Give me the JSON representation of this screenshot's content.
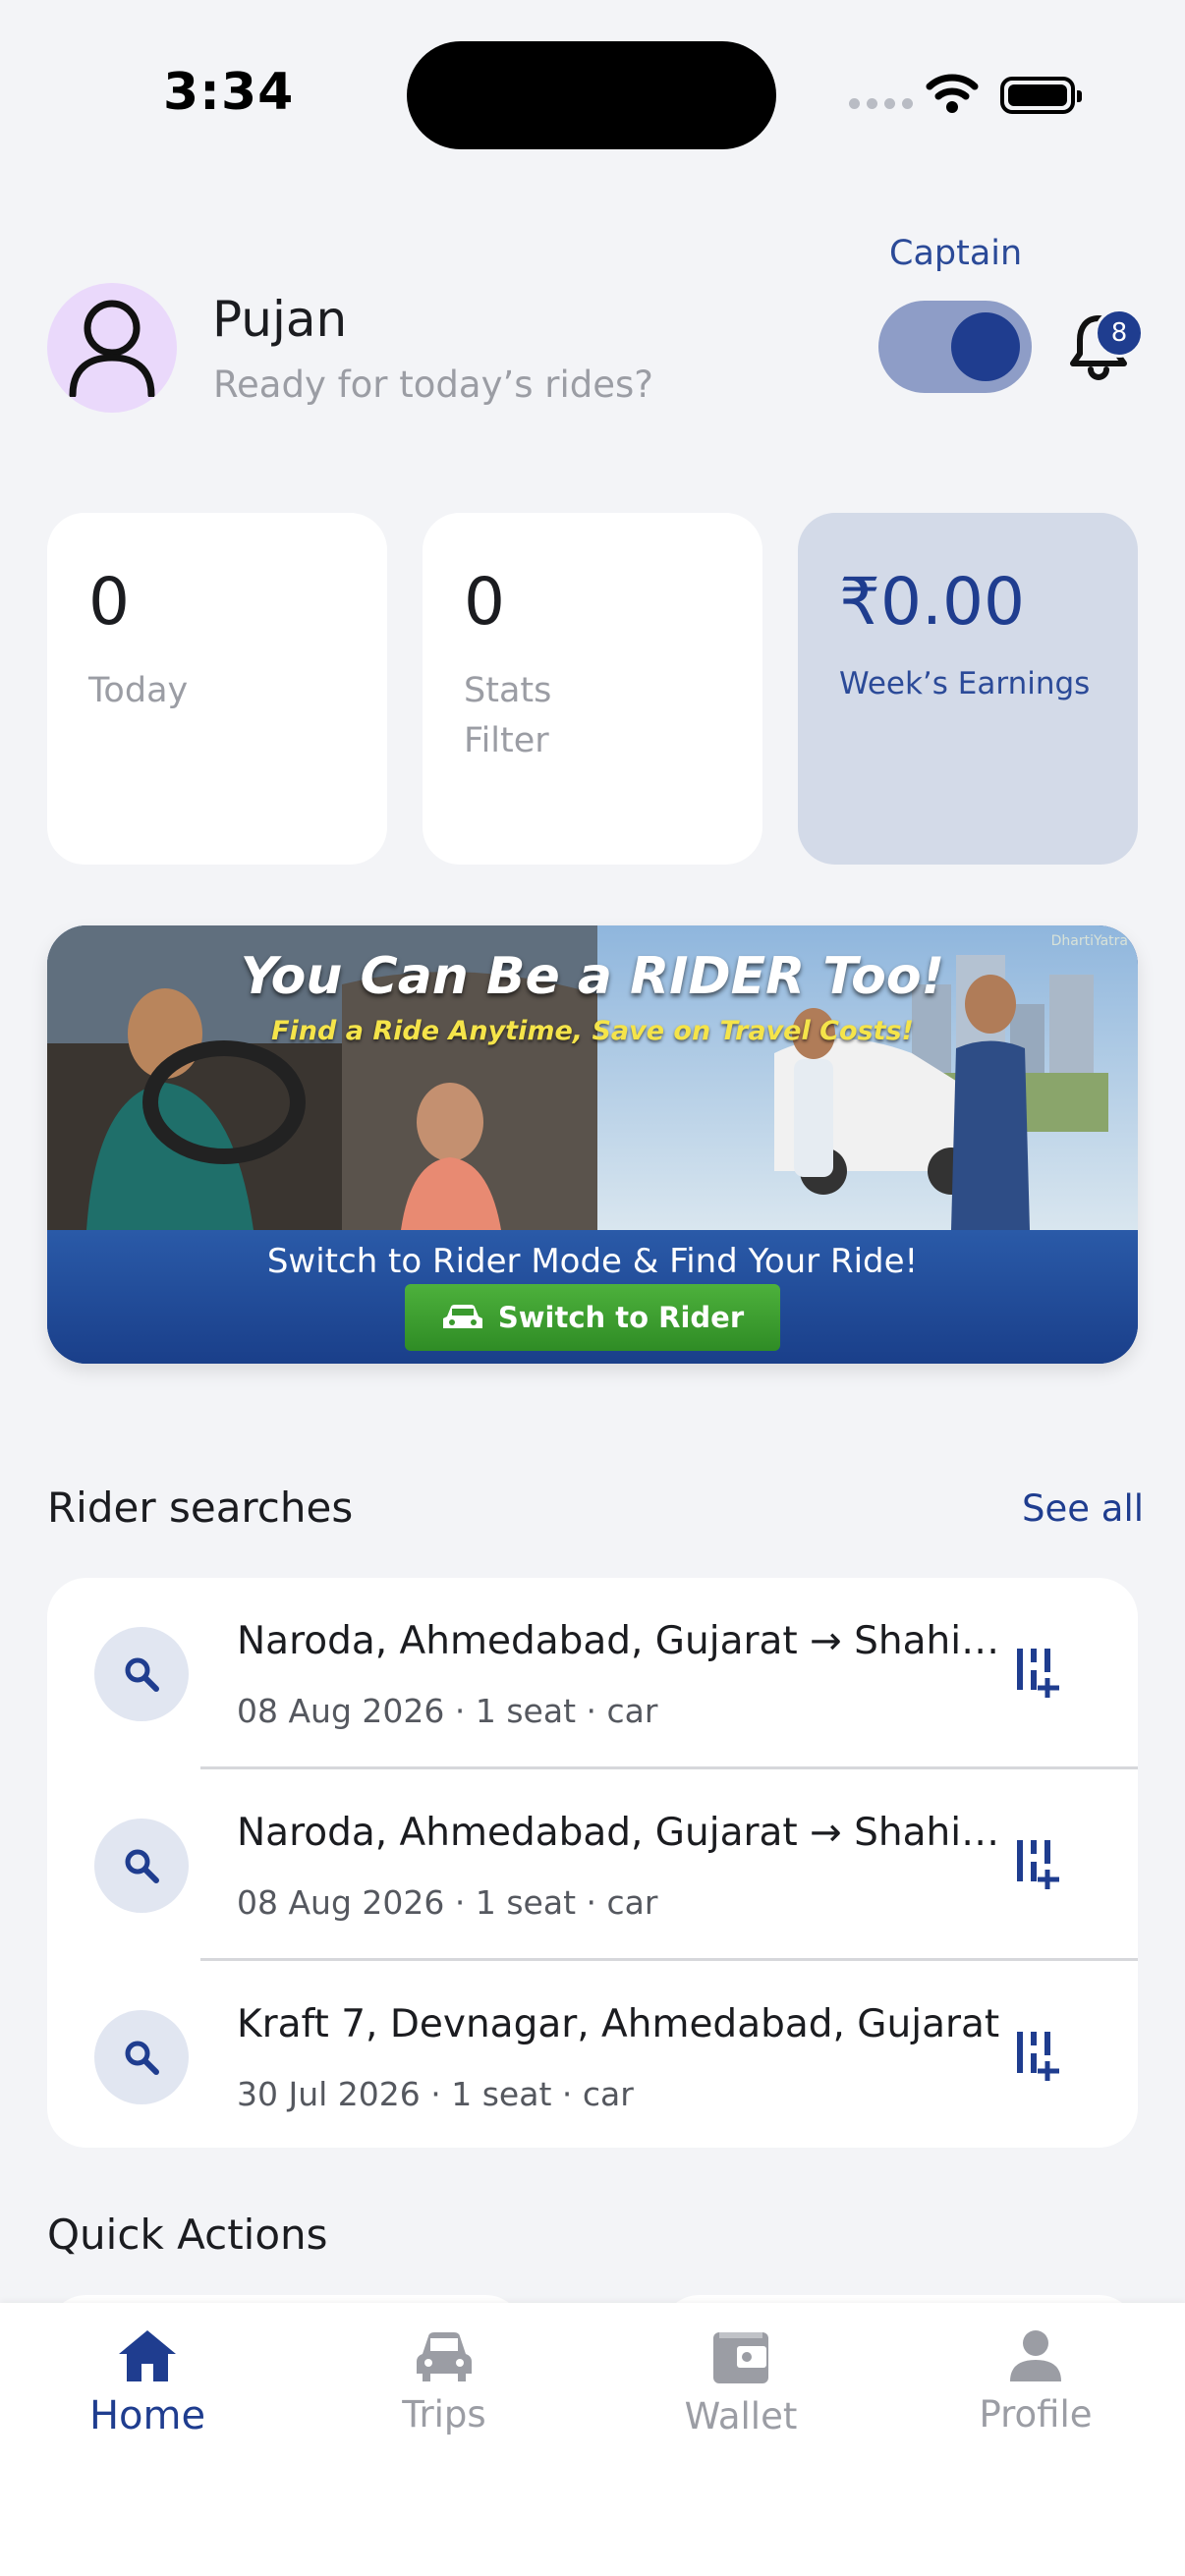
{
  "status_bar": {
    "time": "3:34"
  },
  "header": {
    "user_name": "Pujan",
    "greeting": "Ready for today’s rides?",
    "mode_label": "Captain",
    "notification_count": "8"
  },
  "stats": [
    {
      "value": "0",
      "label": "Today"
    },
    {
      "value": "0",
      "label": "Stats Filter"
    },
    {
      "value": "₹0.00",
      "label": "Week’s Earnings"
    }
  ],
  "banner": {
    "title": "You Can Be a RIDER Too!",
    "subtitle": "Find a Ride Anytime, Save on Travel Costs!",
    "cta_text": "Switch to Rider Mode & Find Your Ride!",
    "button_label": "Switch to Rider",
    "logo_text": "DhartiYatra"
  },
  "rider_searches": {
    "title": "Rider searches",
    "see_all": "See all",
    "items": [
      {
        "route": "Naroda, Ahmedabad, Gujarat → Shahibaug, Ahmedabad",
        "meta": "08 Aug 2026 · 1 seat · car"
      },
      {
        "route": "Naroda, Ahmedabad, Gujarat → Shahibaug, Ahmedabad",
        "meta": "08 Aug 2026 · 1 seat · car"
      },
      {
        "route": "Kraft 7, Devnagar, Ahmedabad, Gujarat",
        "meta": "30 Jul 2026 · 1 seat · car"
      }
    ]
  },
  "quick_actions": {
    "title": "Quick Actions"
  },
  "bottom_nav": [
    {
      "label": "Home",
      "icon": "home-icon",
      "active": true
    },
    {
      "label": "Trips",
      "icon": "car-icon",
      "active": false
    },
    {
      "label": "Wallet",
      "icon": "wallet-icon",
      "active": false
    },
    {
      "label": "Profile",
      "icon": "person-icon",
      "active": false
    }
  ],
  "colors": {
    "primary": "#1f3d8f",
    "background": "#f3f4f7",
    "avatar_bg": "#ead9fb",
    "earnings_card": "#d3dae8",
    "muted_text": "#9b9da4"
  }
}
